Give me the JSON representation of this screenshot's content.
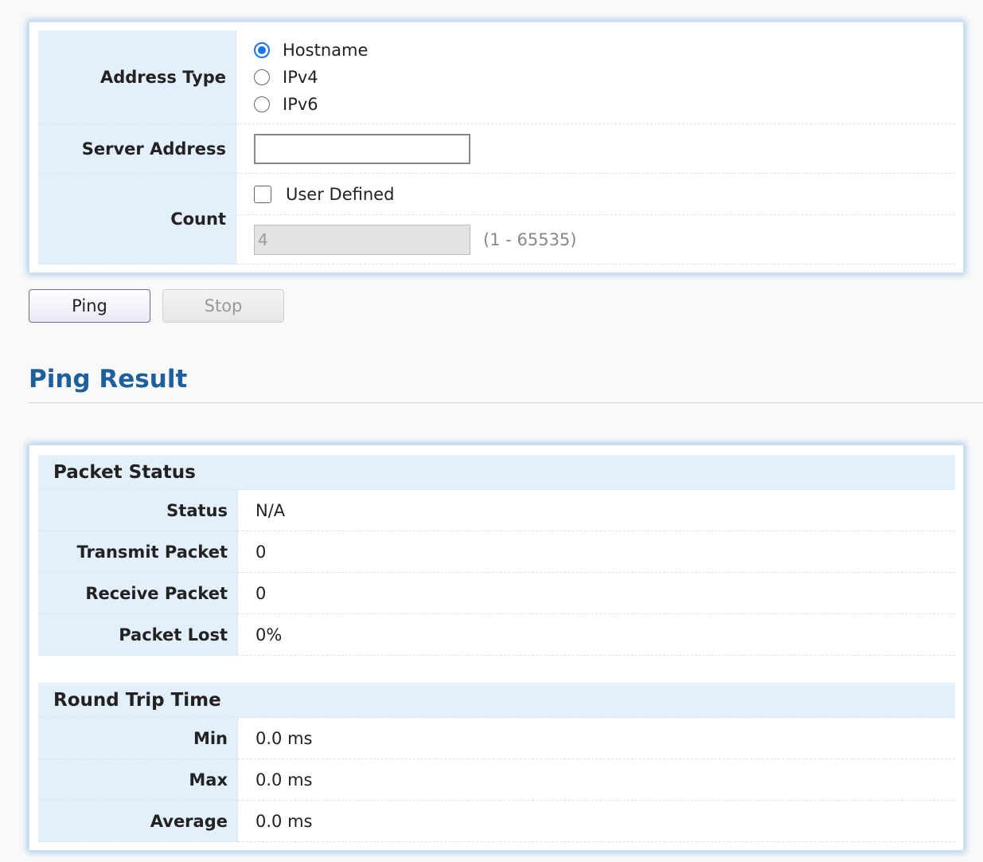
{
  "form": {
    "address_type": {
      "label": "Address Type",
      "options": [
        {
          "label": "Hostname",
          "checked": true
        },
        {
          "label": "IPv4",
          "checked": false
        },
        {
          "label": "IPv6",
          "checked": false
        }
      ]
    },
    "server_address": {
      "label": "Server Address",
      "value": ""
    },
    "count": {
      "label": "Count",
      "user_defined_label": "User Defined",
      "user_defined_checked": false,
      "value": "4",
      "range": "(1 - 65535)"
    }
  },
  "buttons": {
    "ping": "Ping",
    "stop": "Stop"
  },
  "result": {
    "title": "Ping Result",
    "packet_status": {
      "heading": "Packet Status",
      "rows": [
        {
          "label": "Status",
          "value": "N/A"
        },
        {
          "label": "Transmit Packet",
          "value": "0"
        },
        {
          "label": "Receive Packet",
          "value": "0"
        },
        {
          "label": "Packet Lost",
          "value": "0%"
        }
      ]
    },
    "round_trip_time": {
      "heading": "Round Trip Time",
      "rows": [
        {
          "label": "Min",
          "value": "0.0 ms"
        },
        {
          "label": "Max",
          "value": "0.0 ms"
        },
        {
          "label": "Average",
          "value": "0.0 ms"
        }
      ]
    }
  },
  "colors": {
    "accent": "#1a73e8",
    "title": "#1e5f9e",
    "label_bg": "#e3f0fc",
    "panel_glow": "#64a0dc"
  }
}
